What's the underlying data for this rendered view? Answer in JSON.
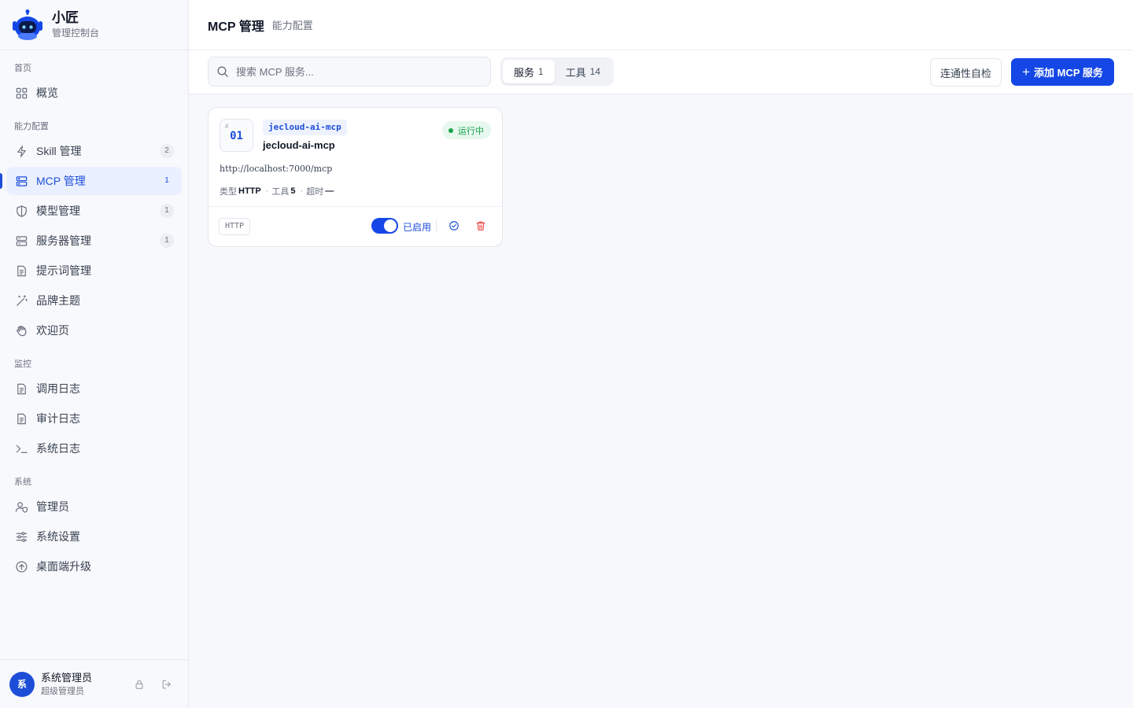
{
  "brand": {
    "title": "小匠",
    "subtitle": "管理控制台"
  },
  "sidebar": {
    "sections": [
      {
        "label": "首页",
        "items": [
          {
            "label": "概览",
            "icon": "grid-icon"
          }
        ]
      },
      {
        "label": "能力配置",
        "items": [
          {
            "label": "Skill 管理",
            "icon": "lightning-icon",
            "badge": "2"
          },
          {
            "label": "MCP 管理",
            "icon": "server-stack-icon",
            "badge": "1",
            "active": true
          },
          {
            "label": "模型管理",
            "icon": "shield-icon",
            "badge": "1"
          },
          {
            "label": "服务器管理",
            "icon": "server-icon",
            "badge": "1"
          },
          {
            "label": "提示词管理",
            "icon": "document-icon"
          },
          {
            "label": "品牌主题",
            "icon": "magic-wand-icon"
          },
          {
            "label": "欢迎页",
            "icon": "wave-hand-icon"
          }
        ]
      },
      {
        "label": "监控",
        "items": [
          {
            "label": "调用日志",
            "icon": "document-icon"
          },
          {
            "label": "审计日志",
            "icon": "document-icon"
          },
          {
            "label": "系统日志",
            "icon": "terminal-icon"
          }
        ]
      },
      {
        "label": "系统",
        "items": [
          {
            "label": "管理员",
            "icon": "user-shield-icon"
          },
          {
            "label": "系统设置",
            "icon": "sliders-icon"
          },
          {
            "label": "桌面端升级",
            "icon": "upload-circle-icon"
          }
        ]
      }
    ]
  },
  "user": {
    "avatar_text": "系",
    "name": "系统管理员",
    "role": "超级管理员"
  },
  "header": {
    "title": "MCP 管理",
    "subtitle": "能力配置"
  },
  "toolbar": {
    "search_placeholder": "搜索 MCP 服务...",
    "tabs": [
      {
        "label": "服务",
        "count": "1",
        "active": true
      },
      {
        "label": "工具",
        "count": "14"
      }
    ],
    "check_label": "连通性自检",
    "add_label": "添加 MCP 服务"
  },
  "card": {
    "hash": "#",
    "index": "01",
    "code": "jecloud-ai-mcp",
    "name": "jecloud-ai-mcp",
    "status": "运行中",
    "url": "http://localhost:7000/mcp",
    "meta": {
      "type_label": "类型",
      "type_value": "HTTP",
      "tools_label": "工具",
      "tools_value": "5",
      "timeout_label": "超时",
      "timeout_value": "—",
      "sep": "·"
    },
    "type_chip": "HTTP",
    "enabled_label": "已启用"
  },
  "colors": {
    "accent": "#1447e6",
    "success": "#16a34a",
    "danger": "#ef4444"
  }
}
